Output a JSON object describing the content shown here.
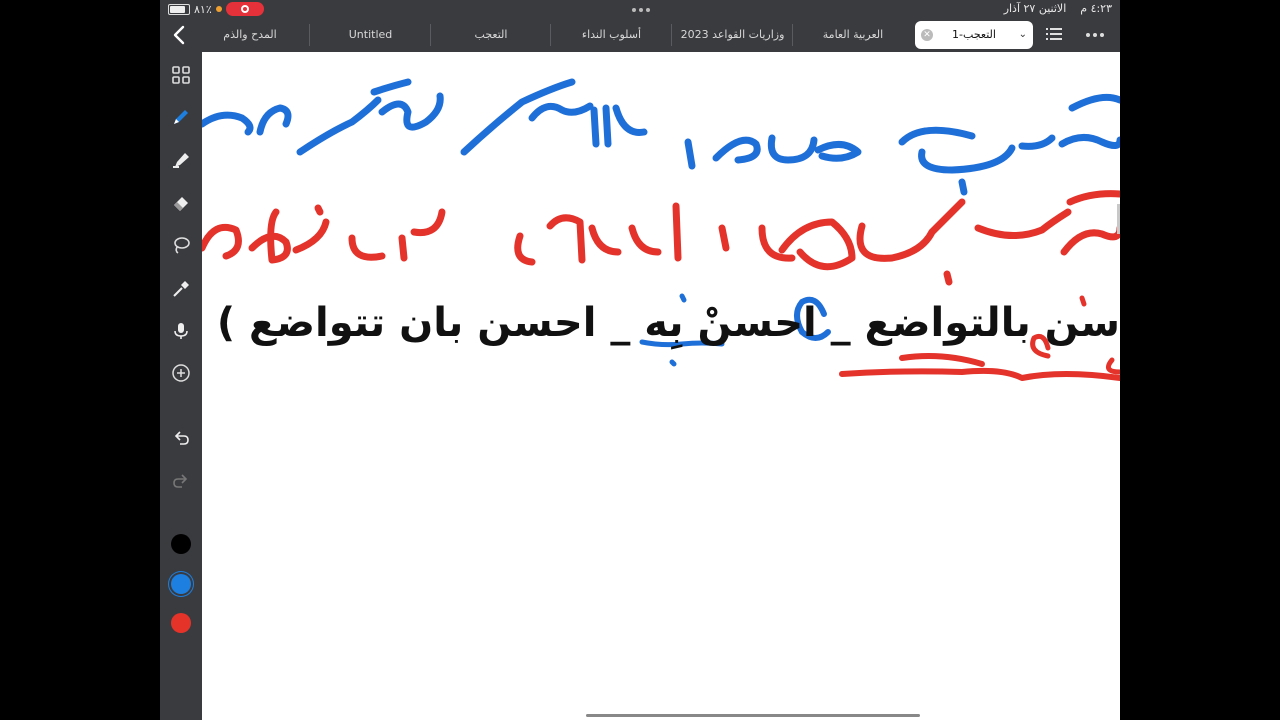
{
  "status": {
    "time": "٤:٢٣ م",
    "date": "الاثنين ٢٧ آذار",
    "battery_label": "٨١٪",
    "battery_level": 0.81
  },
  "tabs": [
    {
      "label": "التعجب-1",
      "active": true
    },
    {
      "label": "العربية العامة",
      "active": false
    },
    {
      "label": "وزاريات القواعد 2023",
      "active": false
    },
    {
      "label": "أسلوب النداء",
      "active": false
    },
    {
      "label": "التعجب",
      "active": false
    },
    {
      "label": "Untitled",
      "active": false
    },
    {
      "label": "المدح والذم",
      "active": false
    }
  ],
  "toolbar": {
    "tools": [
      "grid-icon",
      "pen-icon",
      "highlighter-icon",
      "eraser-icon",
      "lasso-icon",
      "eyedropper-icon",
      "microphone-icon",
      "add-icon",
      "undo-icon",
      "redo-icon"
    ],
    "colors": [
      "#000000",
      "#1d7fe0",
      "#e5332a"
    ],
    "selected_color": "#1d7fe0"
  },
  "document": {
    "typed_line": "سن بالتواضع _ احسنْ بِه _ احسن بان تتواضع )",
    "ink_blue": "#1f6fd8",
    "ink_red": "#e3332b"
  }
}
